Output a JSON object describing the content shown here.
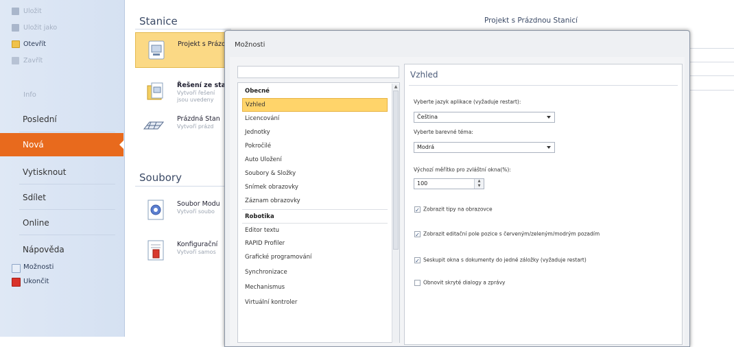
{
  "sidebar": {
    "top_items": [
      {
        "label": "Uložit",
        "icon": "save-icon",
        "dim": true
      },
      {
        "label": "Uložit jako",
        "icon": "save-as-icon",
        "dim": true
      },
      {
        "label": "Otevřít",
        "icon": "folder-open-icon",
        "dim": false
      },
      {
        "label": "Zavřít",
        "icon": "close-file-icon",
        "dim": true
      }
    ],
    "info_label": "Info",
    "nav": [
      "Poslední",
      "Nová",
      "Vytisknout",
      "Sdílet",
      "Online",
      "Nápověda"
    ],
    "active_nav": "Nová",
    "bottom_items": [
      {
        "label": "Možnosti",
        "icon": "options-icon"
      },
      {
        "label": "Ukončit",
        "icon": "exit-icon"
      }
    ],
    "accent": "#e86a1d"
  },
  "main": {
    "stations_title": "Stanice",
    "files_title": "Soubory",
    "right_title": "Projekt s Prázdnou Stanicí",
    "station_tiles": [
      {
        "title": "Projekt s Prázdnou",
        "desc": "",
        "icon": "project-icon",
        "selected": true
      },
      {
        "title": "Řešení ze sta",
        "desc": "Vytvoří řešení\njsou uvedeny",
        "icon": "solution-icon",
        "selected": false
      },
      {
        "title": "Prázdná Stan",
        "desc": "Vytvoří prázd",
        "icon": "station-icon",
        "selected": false
      }
    ],
    "file_tiles": [
      {
        "title": "Soubor Modu",
        "desc": "Vytvoří soubo",
        "icon": "module-file-icon"
      },
      {
        "title": "Konfigurační",
        "desc": "Vytvoří samos",
        "icon": "config-file-icon"
      }
    ]
  },
  "dialog": {
    "title": "Možnosti",
    "search_value": "",
    "categories": [
      {
        "label": "Obecné",
        "type": "header"
      },
      {
        "label": "Vzhled",
        "type": "item",
        "selected": true
      },
      {
        "label": "Licencování",
        "type": "item"
      },
      {
        "label": "Jednotky",
        "type": "item"
      },
      {
        "label": "Pokročilé",
        "type": "item"
      },
      {
        "label": "Auto Uložení",
        "type": "item"
      },
      {
        "label": "Soubory & Složky",
        "type": "item"
      },
      {
        "label": "Snímek obrazovky",
        "type": "item"
      },
      {
        "label": "Záznam obrazovky",
        "type": "item"
      },
      {
        "label": "Robotika",
        "type": "header"
      },
      {
        "label": "Editor textu",
        "type": "item"
      },
      {
        "label": "RAPID Profiler",
        "type": "item"
      },
      {
        "label": "Grafické programování",
        "type": "item"
      },
      {
        "label": "Synchronizace",
        "type": "item"
      },
      {
        "label": "Mechanismus",
        "type": "item"
      },
      {
        "label": "Virtuální kontroler",
        "type": "item"
      }
    ],
    "panel": {
      "title": "Vzhled",
      "language_label": "Vyberte jazyk aplikace (vyžaduje restart):",
      "language_value": "Čeština",
      "theme_label": "Vyberte barevné téma:",
      "theme_value": "Modrá",
      "scale_label": "Výchozí měřítko pro zvláštní okna(%):",
      "scale_value": "100",
      "checks": [
        {
          "label": "Zobrazit tipy na obrazovce",
          "checked": true
        },
        {
          "label": "Zobrazit editační pole pozice s červeným/zeleným/modrým pozadím",
          "checked": true
        },
        {
          "label": "Seskupit okna s dokumenty do jedné záložky (vyžaduje restart)",
          "checked": true
        },
        {
          "label": "Obnovit skryté dialogy a zprávy",
          "checked": false
        }
      ]
    }
  }
}
